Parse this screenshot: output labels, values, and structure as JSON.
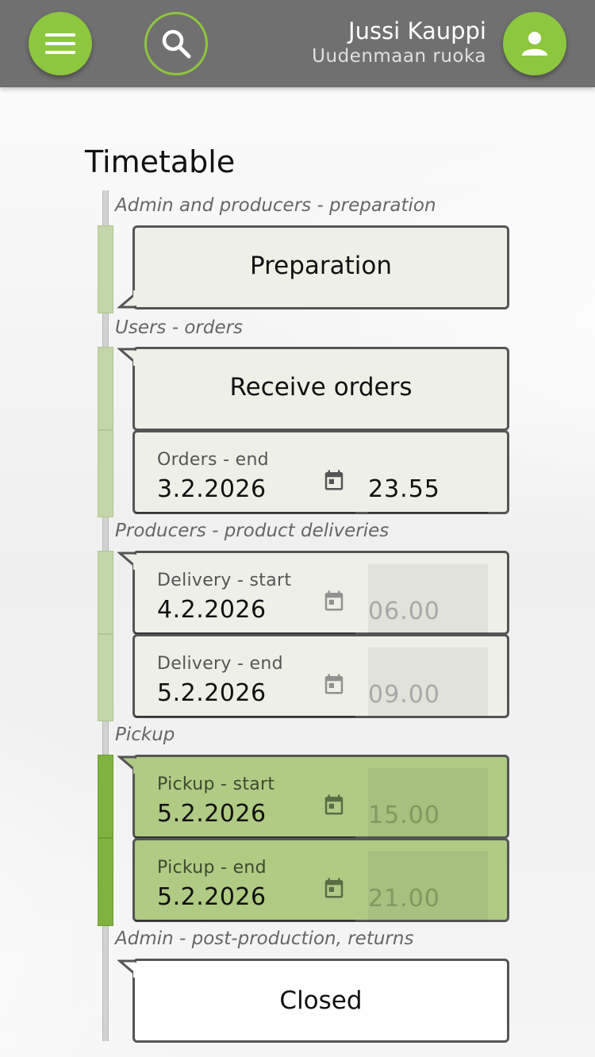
{
  "header": {
    "menu_icon": "hamburger-icon",
    "search_icon": "search-icon",
    "user_icon": "person-icon",
    "user_name": "Jussi Kauppi",
    "organization": "Uudenmaan ruoka",
    "accent_color": "#8dc63f",
    "bar_color": "#707070"
  },
  "timetable": {
    "title": "Timetable",
    "phases": [
      {
        "label": "Admin and producers - preparation"
      },
      {
        "label": "Users - orders"
      },
      {
        "label": "Producers - product deliveries"
      },
      {
        "label": "Pickup"
      },
      {
        "label": "Admin - post-production, returns"
      }
    ],
    "preparation": {
      "label": "Preparation"
    },
    "receive_orders": {
      "label": "Receive orders"
    },
    "orders_end": {
      "label": "Orders - end",
      "date": "3.2.2026",
      "time": "23.55"
    },
    "delivery_start": {
      "label": "Delivery - start",
      "date": "4.2.2026",
      "time": "06.00"
    },
    "delivery_end": {
      "label": "Delivery - end",
      "date": "5.2.2026",
      "time": "09.00"
    },
    "pickup_start": {
      "label": "Pickup - start",
      "date": "5.2.2026",
      "time": "15.00"
    },
    "pickup_end": {
      "label": "Pickup - end",
      "date": "5.2.2026",
      "time": "21.00"
    },
    "closed": {
      "label": "Closed"
    },
    "active_phase_color": "#7fb23f",
    "calendar_icon": "calendar-icon"
  }
}
